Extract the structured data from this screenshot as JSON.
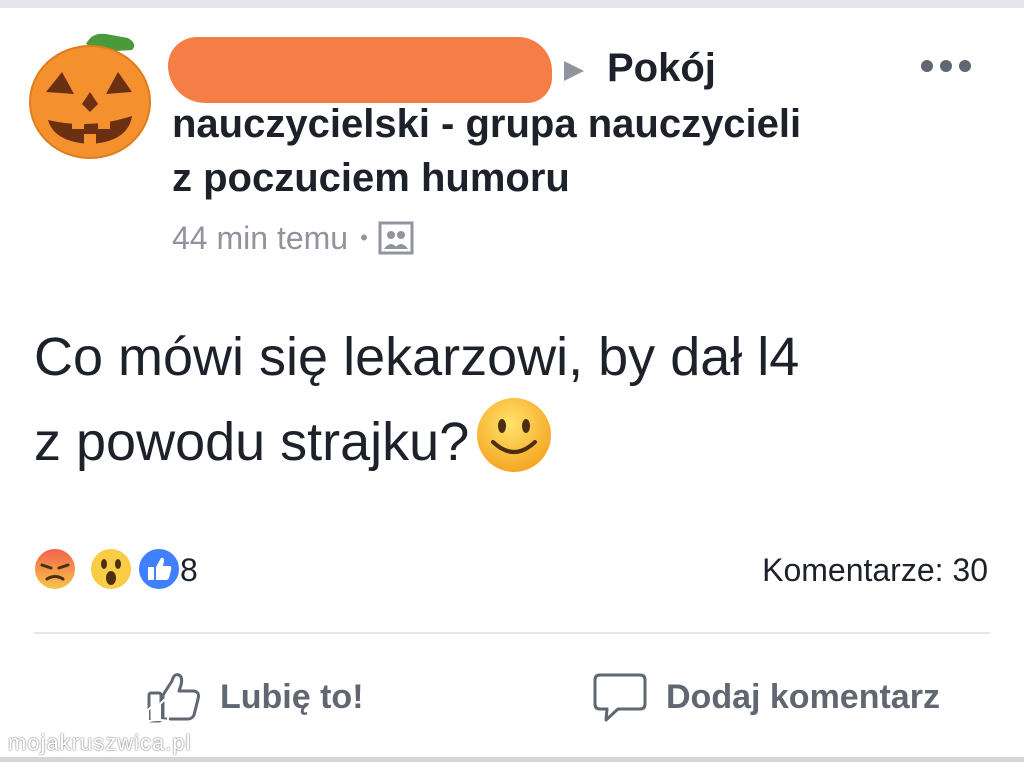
{
  "post": {
    "group_line1": "Pokój",
    "group_line2": "nauczycielski - grupa nauczycieli",
    "group_line3": "z poczuciem humoru",
    "timestamp": "44 min temu",
    "separator": "•",
    "text_line1": "Co mówi się lekarzowi, by dał l4",
    "text_line2": "z powodu strajku?",
    "avatar_icon": "pumpkin-icon",
    "audience_icon": "photo-audience-icon"
  },
  "reactions": {
    "icons": [
      "angry-reaction-icon",
      "wow-reaction-icon",
      "like-reaction-icon"
    ],
    "count": "8",
    "comments": "Komentarze: 30"
  },
  "actions": {
    "like_label": "Lubię to!",
    "comment_label": "Dodaj komentarz"
  },
  "watermark": {
    "text": "mojakruszwica.pl"
  },
  "colors": {
    "text": "#1d2129",
    "secondary_text": "#90949c",
    "action_text": "#606770",
    "redaction": "#f47e45",
    "like_blue": "#4080ff"
  }
}
